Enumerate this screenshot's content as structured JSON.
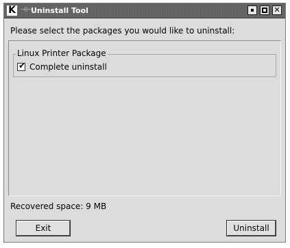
{
  "window": {
    "title": "Uninstall Tool",
    "app_icon_letter": "K",
    "titlebar_buttons": [
      "minimize-icon",
      "maximize-icon",
      "close-icon"
    ],
    "close_glyph": "✕"
  },
  "main": {
    "instruction": "Please select the packages you would like to uninstall:",
    "packages": [
      {
        "name": "Linux Printer Package",
        "options": [
          {
            "label": "Complete uninstall",
            "checked": true,
            "check_glyph": "✔"
          }
        ]
      }
    ]
  },
  "footer": {
    "recovered_space": "Recovered space:  9 MB",
    "exit_label": "Exit",
    "uninstall_label": "Uninstall"
  },
  "colors": {
    "window_bg": "#dcdcdc",
    "titlebar_bg": "#626262",
    "title_text": "#ffffff"
  }
}
